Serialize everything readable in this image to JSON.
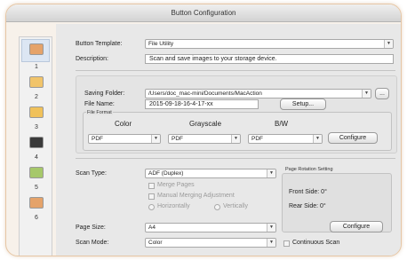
{
  "window": {
    "title": "Button Configuration"
  },
  "sidebar": {
    "items": [
      {
        "number": "1",
        "icon": "image-file-icon",
        "selected": true
      },
      {
        "number": "2",
        "icon": "ocr-icon"
      },
      {
        "number": "3",
        "icon": "folder-icon"
      },
      {
        "number": "4",
        "icon": "printer-icon"
      },
      {
        "number": "5",
        "icon": "application-icon"
      },
      {
        "number": "6",
        "icon": "image-file-icon"
      }
    ]
  },
  "header": {
    "template_label": "Button Template:",
    "template_value": "File Utility",
    "description_label": "Description:",
    "description_value": "Scan and save images to your storage device."
  },
  "saving": {
    "folder_label": "Saving Folder:",
    "folder_value": "/Users/doc_mac-mini/Documents/MacAction",
    "browse_label": "...",
    "file_name_label": "File Name:",
    "file_name_value": "2015-09-18-16-4-17-xx",
    "setup_label": "Setup...",
    "file_format_label": "File Format",
    "color_label": "Color",
    "grayscale_label": "Grayscale",
    "bw_label": "B/W",
    "color_format": "PDF",
    "grayscale_format": "PDF",
    "bw_format": "PDF",
    "configure_label": "Configure"
  },
  "scan": {
    "scan_type_label": "Scan Type:",
    "scan_type_value": "ADF (Duplex)",
    "merge_pages": "Merge Pages",
    "manual_merging": "Manual Merging Adjustment",
    "horizontally": "Horizontally",
    "vertically": "Vertically",
    "page_size_label": "Page Size:",
    "page_size_value": "A4",
    "scan_mode_label": "Scan Mode:",
    "scan_mode_value": "Color",
    "continuous_scan": "Continuous Scan"
  },
  "rotation": {
    "title": "Page Rotation Setting",
    "front_side": "Front Side: 0°",
    "rear_side": "Rear Side: 0°",
    "configure_label": "Configure"
  }
}
